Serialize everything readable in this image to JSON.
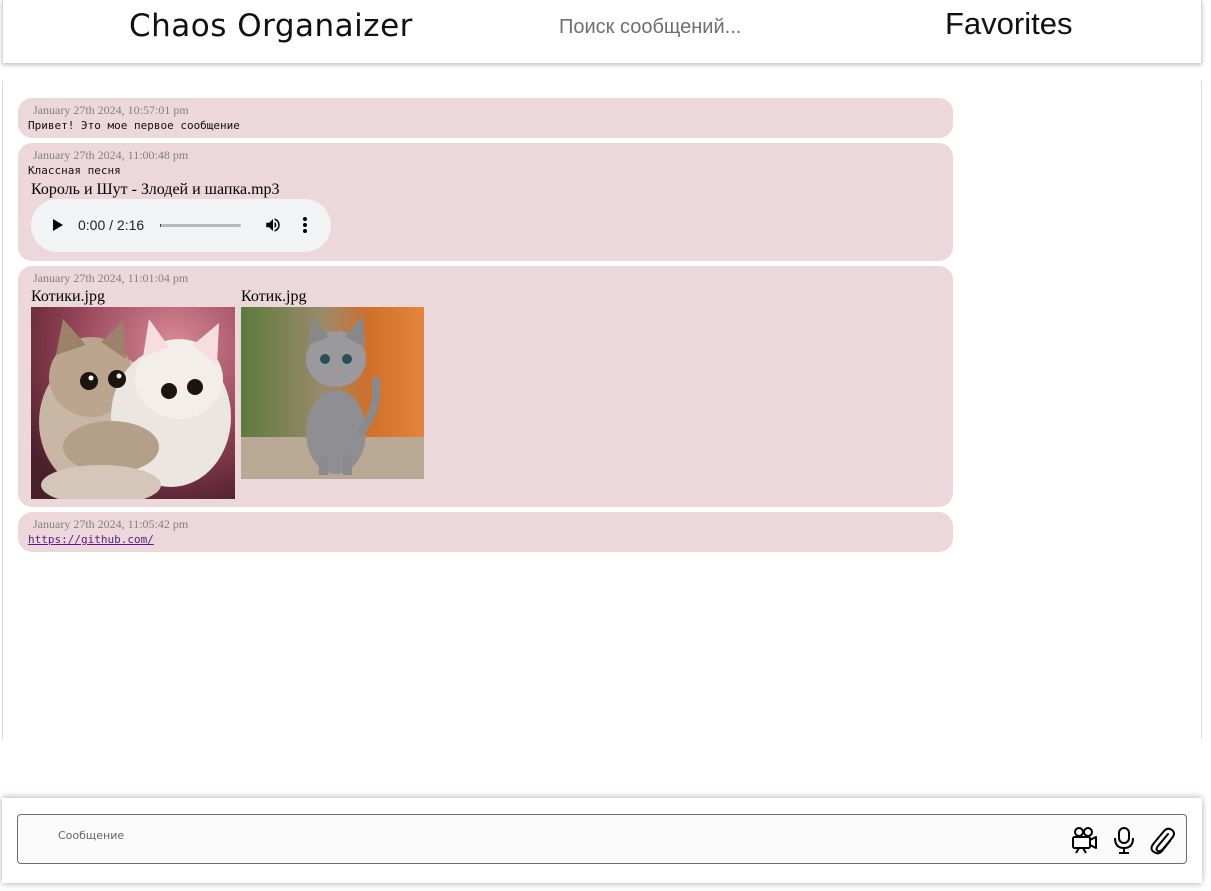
{
  "header": {
    "title": "Chaos Organaizer",
    "search_placeholder": "Поиск сообщений...",
    "favorites_label": "Favorites"
  },
  "messages": [
    {
      "timestamp": "January 27th 2024, 10:57:01 pm",
      "text": "Привет! Это мое первое сообщение"
    },
    {
      "timestamp": "January 27th 2024, 11:00:48 pm",
      "text": "Классная песня",
      "audio": {
        "file_name": "Король и Шут - Злодей и шапка.mp3",
        "time": "0:00 / 2:16",
        "progress": 0.0
      }
    },
    {
      "timestamp": "January 27th 2024, 11:01:04 pm",
      "images": [
        {
          "file_name": "Котики.jpg"
        },
        {
          "file_name": "Котик.jpg"
        }
      ]
    },
    {
      "timestamp": "January 27th 2024, 11:05:42 pm",
      "link": "https://github.com/"
    }
  ],
  "composer": {
    "placeholder": "Сообщение",
    "icons": [
      "video-camera-icon",
      "microphone-icon",
      "paperclip-icon"
    ]
  },
  "colors": {
    "message_bg": "#ecd8da",
    "timestamp": "#808080",
    "link": "#5a1a8a",
    "audio_bg": "#f1f3f4"
  }
}
